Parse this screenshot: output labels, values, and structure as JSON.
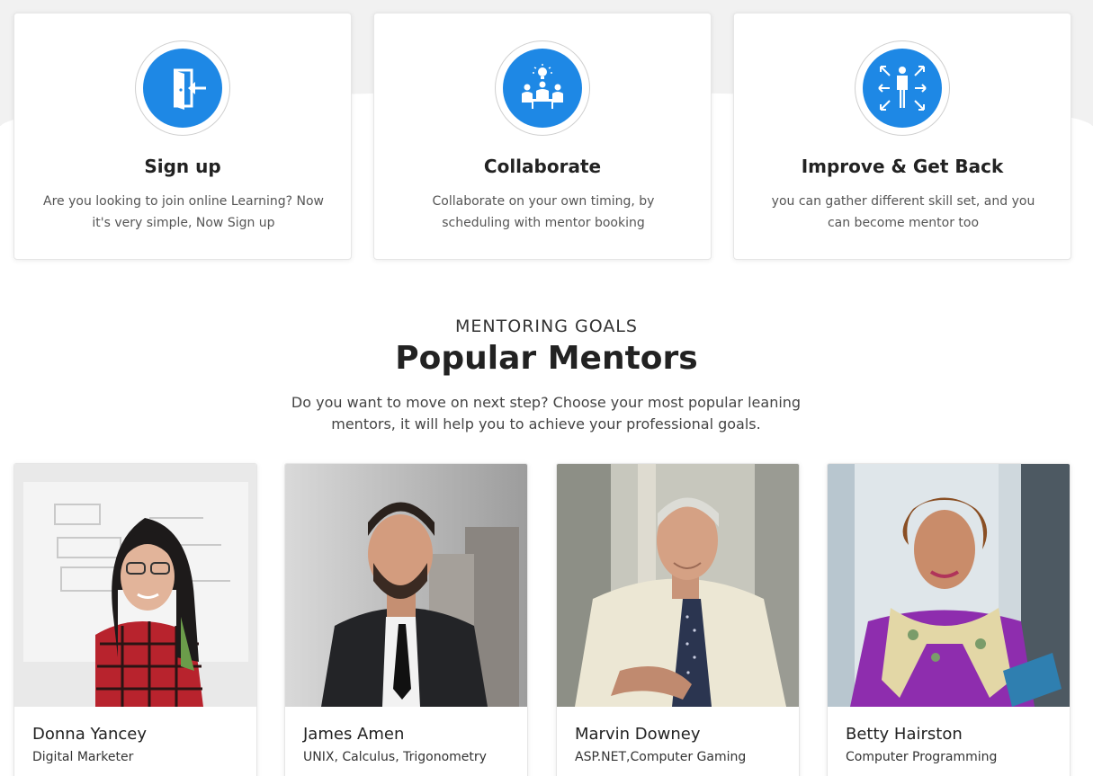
{
  "steps": [
    {
      "icon": "door-enter-icon",
      "title": "Sign up",
      "desc": "Are you looking to join online Learning? Now it's very simple, Now Sign up"
    },
    {
      "icon": "team-idea-icon",
      "title": "Collaborate",
      "desc": "Collaborate on your own timing, by scheduling with mentor booking"
    },
    {
      "icon": "person-growth-icon",
      "title": "Improve & Get Back",
      "desc": "you can gather different skill set, and you can become mentor too"
    }
  ],
  "section": {
    "kicker": "MENTORING GOALS",
    "title": "Popular Mentors",
    "desc": "Do you want to move on next step? Choose your most popular leaning mentors, it will help you to achieve your professional goals."
  },
  "mentors": [
    {
      "name": "Donna Yancey",
      "skill": "Digital Marketer"
    },
    {
      "name": "James Amen",
      "skill": "UNIX, Calculus, Trigonometry"
    },
    {
      "name": "Marvin Downey",
      "skill": "ASP.NET,Computer Gaming"
    },
    {
      "name": "Betty Hairston",
      "skill": "Computer Programming"
    }
  ],
  "colors": {
    "accent": "#1e88e5",
    "band": "#f1f1f1"
  }
}
